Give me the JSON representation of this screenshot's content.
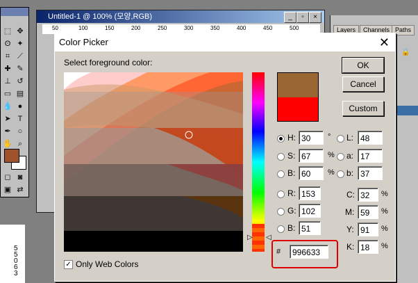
{
  "document": {
    "title": "Untitled-1 @ 100% (모양,RGB)",
    "ruler_labels": [
      "50",
      "100",
      "150",
      "200",
      "250",
      "300",
      "350",
      "400",
      "450",
      "500"
    ]
  },
  "layers_palette": {
    "tabs": [
      "Layers",
      "Channels",
      "Paths"
    ]
  },
  "side_ruler": {
    "labels": [
      "5",
      "5",
      "0",
      "6",
      "3"
    ]
  },
  "dialog": {
    "title": "Color Picker",
    "prompt": "Select foreground color:",
    "buttons": {
      "ok": "OK",
      "cancel": "Cancel",
      "custom": "Custom"
    },
    "colors": {
      "new": "#996633",
      "current": "#ff0000"
    },
    "hsb": {
      "h": {
        "label": "H:",
        "value": "30",
        "unit": "°"
      },
      "s": {
        "label": "S:",
        "value": "67",
        "unit": "%"
      },
      "b": {
        "label": "B:",
        "value": "60",
        "unit": "%"
      }
    },
    "rgb": {
      "r": {
        "label": "R:",
        "value": "153"
      },
      "g": {
        "label": "G:",
        "value": "102"
      },
      "b": {
        "label": "B:",
        "value": "51"
      }
    },
    "lab": {
      "l": {
        "label": "L:",
        "value": "48"
      },
      "a": {
        "label": "a:",
        "value": "17"
      },
      "b": {
        "label": "b:",
        "value": "37"
      }
    },
    "cmyk": {
      "c": {
        "label": "C:",
        "value": "32",
        "unit": "%"
      },
      "m": {
        "label": "M:",
        "value": "59",
        "unit": "%"
      },
      "y": {
        "label": "Y:",
        "value": "91",
        "unit": "%"
      },
      "k": {
        "label": "K:",
        "value": "18",
        "unit": "%"
      }
    },
    "hex": {
      "label": "#",
      "value": "996633"
    },
    "web_only": {
      "label": "Only Web Colors",
      "checked": true
    },
    "selected_mode": "H"
  }
}
